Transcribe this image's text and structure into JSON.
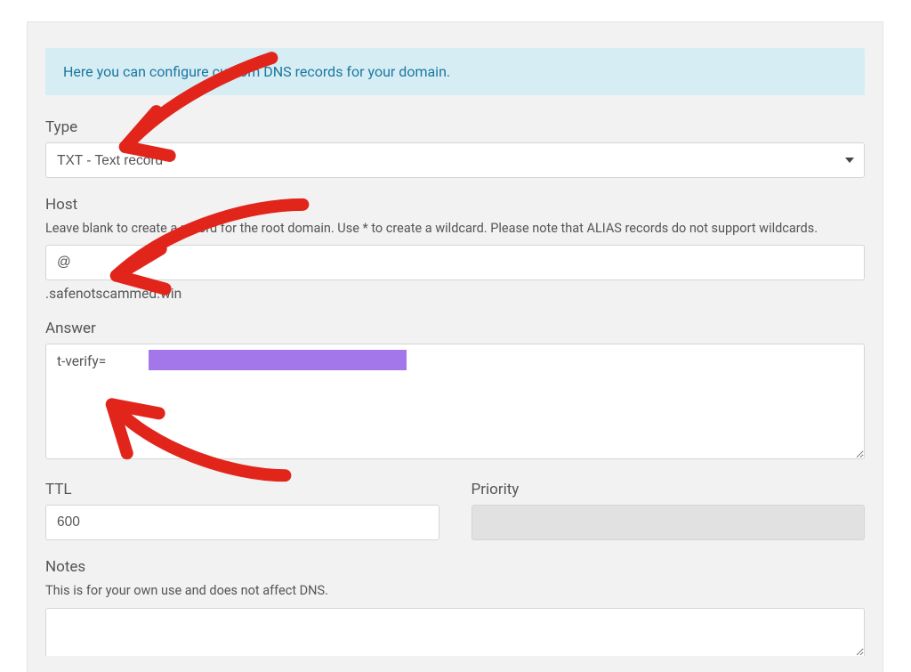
{
  "info_text": "Here you can configure custom DNS records for your domain.",
  "type": {
    "label": "Type",
    "selected": "TXT - Text record"
  },
  "host": {
    "label": "Host",
    "helper": "Leave blank to create a record for the root domain. Use * to create a wildcard. Please note that ALIAS records do not support wildcards.",
    "value": "@",
    "suffix": ".safenotscammed.win"
  },
  "answer": {
    "label": "Answer",
    "value": "t-verify="
  },
  "ttl": {
    "label": "TTL",
    "value": "600"
  },
  "priority": {
    "label": "Priority"
  },
  "notes": {
    "label": "Notes",
    "helper": "This is for your own use and does not affect DNS."
  },
  "annotation_color": "#e1251b"
}
